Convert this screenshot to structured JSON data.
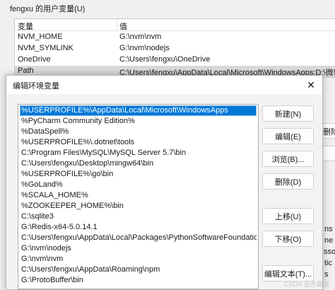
{
  "background_window": {
    "group_title": "fengxu 的用户变量(U)",
    "columns": {
      "variable": "变量",
      "value": "值"
    },
    "rows": [
      {
        "name": "NVM_HOME",
        "value": "G:\\nvm\\nvm"
      },
      {
        "name": "NVM_SYMLINK",
        "value": "G:\\nvm\\nodejs"
      },
      {
        "name": "OneDrive",
        "value": "C:\\Users\\fengxu\\OneDrive"
      },
      {
        "name": "Path",
        "value": "C:\\Users\\fengxu\\AppData\\Local\\Microsoft\\WindowsApps;D:\\微软..."
      }
    ],
    "right_fragments": {
      "delete_partial": "删除",
      "ns": "ns",
      "ne": "ne",
      "ssor": "ssor",
      "tic": "tic",
      "s": "s"
    }
  },
  "dialog": {
    "title": "编辑环境变量",
    "close_glyph": "✕",
    "path_entries": [
      "%USERPROFILE%\\AppData\\Local\\Microsoft\\WindowsApps",
      "%PyCharm Community Edition%",
      "%DataSpell%",
      "%USERPROFILE%\\.dotnet\\tools",
      "C:\\Program Files\\MySQL\\MySQL Server 5.7\\bin",
      "C:\\Users\\fengxu\\Desktop\\mingw64\\bin",
      "%USERPROFILE%\\go\\bin",
      "%GoLand%",
      "%SCALA_HOME%",
      "%ZOOKEEPER_HOME%\\bin",
      "C:\\sqlite3",
      "G:\\Redis-x64-5.0.14.1",
      "C:\\Users\\fengxu\\AppData\\Local\\Packages\\PythonSoftwareFoundation...",
      "G:\\nvm\\nodejs",
      "G:\\nvm\\nvm",
      "C:\\Users\\fengxu\\AppData\\Roaming\\npm",
      "G:\\ProtoBuffer\\bin"
    ],
    "selected_index": 0,
    "buttons": {
      "new": "新建(N)",
      "edit": "编辑(E)",
      "browse": "浏览(B)...",
      "delete": "删除(D)",
      "move_up": "上移(U)",
      "move_down": "下移(O)",
      "edit_text": "编辑文本(T)..."
    }
  },
  "watermark": "CSDN @恶霸俊"
}
